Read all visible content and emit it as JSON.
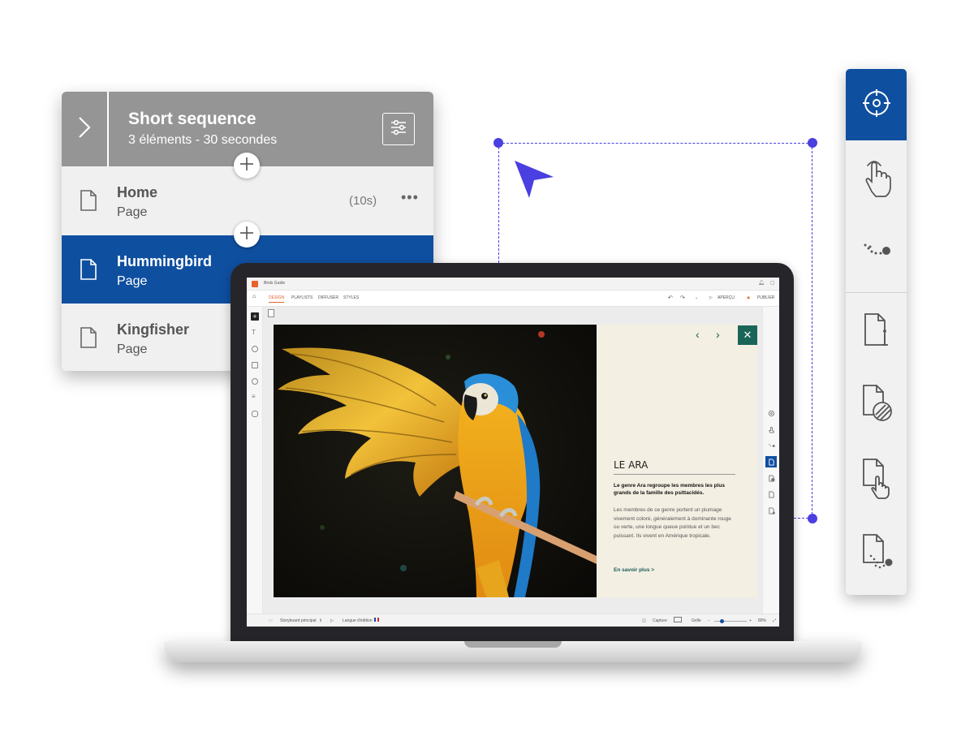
{
  "sequence_panel": {
    "title": "Short sequence",
    "subtitle": "3 éléments - 30 secondes",
    "expand_icon": "chevron-right-icon",
    "settings_icon": "sliders-icon",
    "items": [
      {
        "name": "Home",
        "type": "Page",
        "duration": "(10s)",
        "selected": false
      },
      {
        "name": "Hummingbird",
        "type": "Page",
        "selected": true
      },
      {
        "name": "Kingfisher",
        "type": "Page",
        "selected": false
      }
    ]
  },
  "toolbar": {
    "accent_color": "#0f4fa0",
    "tools": [
      {
        "icon": "target-icon",
        "active": true
      },
      {
        "icon": "touch-hand-icon",
        "active": false
      },
      {
        "icon": "motion-path-icon",
        "active": false
      },
      {
        "icon": "page-info-icon",
        "active": false
      },
      {
        "icon": "page-background-icon",
        "active": false
      },
      {
        "icon": "page-touch-icon",
        "active": false
      },
      {
        "icon": "page-motion-icon",
        "active": false
      }
    ]
  },
  "selection": {
    "color": "#4a3fe0",
    "cursor_icon": "arrow-cursor-icon"
  },
  "app": {
    "window_title": "Birds Guide",
    "tabs": [
      "DESIGN",
      "PLAYLISTS",
      "DIFFUSER",
      "STYLES"
    ],
    "active_tab": "DESIGN",
    "preview_label": "APERÇU",
    "publish_label": "PUBLIER",
    "slide": {
      "title": "LE ARA",
      "lead": "Le genre Ara regroupe les membres les plus grands de la famille des psittacidés.",
      "body": "Les membres de ce genre portent un plumage vivement coloré, généralement à dominante rouge ou verte, une longue queue pointue et un bec puissant. Ils vivent en Amérique tropicale.",
      "link": "En savoir plus >",
      "accent_color": "#1a6558",
      "background_color": "#f3efe2"
    },
    "status": {
      "storyboard": "Storyboard principal",
      "language": "Langue d'édition",
      "capture": "Capture",
      "grid": "Grille",
      "zoom": "80%"
    }
  }
}
